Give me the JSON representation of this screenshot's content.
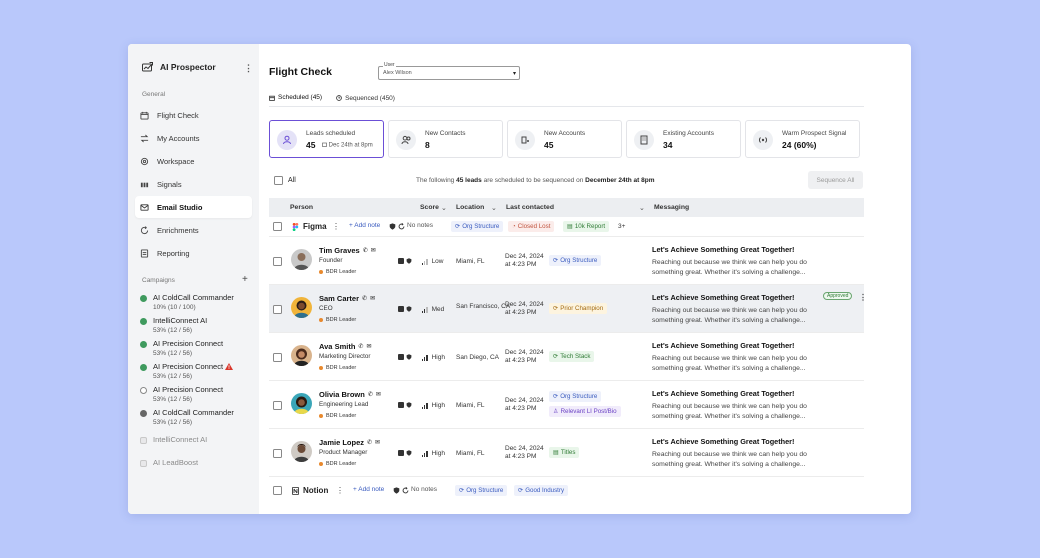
{
  "sidebar": {
    "app_name": "AI Prospector",
    "more": "⋮",
    "general_label": "General",
    "nav": [
      {
        "label": "Flight Check"
      },
      {
        "label": "My Accounts"
      },
      {
        "label": "Workspace"
      },
      {
        "label": "Signals"
      },
      {
        "label": "Email Studio"
      },
      {
        "label": "Enrichments"
      },
      {
        "label": "Reporting"
      }
    ],
    "campaigns_label": "Campaigns",
    "campaigns_add": "+",
    "campaigns": [
      {
        "name": "AI ColdCall Commander",
        "stat": "10% (10 / 100)"
      },
      {
        "name": "IntelliConnect AI",
        "stat": "53% (12 / 56)"
      },
      {
        "name": "AI Precision Connect",
        "stat": "53% (12 / 56)"
      },
      {
        "name": "AI Precision Connect",
        "stat": "53% (12 / 56)"
      },
      {
        "name": "AI Precision Connect",
        "stat": "53% (12 / 56)"
      },
      {
        "name": "AI ColdCall Commander",
        "stat": "53% (12 / 56)"
      },
      {
        "name": "IntelliConnect AI",
        "stat": ""
      },
      {
        "name": "AI LeadBoost",
        "stat": ""
      }
    ]
  },
  "header": {
    "title": "Flight Check",
    "user_label": "User",
    "user_value": "Alex Wilson",
    "caret": "▾"
  },
  "tabs": [
    {
      "label": "Scheduled (45)"
    },
    {
      "label": "Sequenced (450)"
    }
  ],
  "stats": [
    {
      "label": "Leads scheduled",
      "value": "45",
      "sub": "Dec 24th at 8pm"
    },
    {
      "label": "New Contacts",
      "value": "8"
    },
    {
      "label": "New Accounts",
      "value": "45"
    },
    {
      "label": "Existing Accounts",
      "value": "34"
    },
    {
      "label": "Warm Prospect Signal",
      "value": "24 (60%)"
    }
  ],
  "toolbar": {
    "all_label": "All",
    "note_pre": "The following ",
    "note_count": "45 leads",
    "note_mid": " are scheduled to be sequenced on ",
    "note_date": "December 24th at 8pm",
    "sequence_all": "Sequence All"
  },
  "columns": {
    "person": "Person",
    "score": "Score",
    "location": "Location",
    "last_contacted": "Last contacted",
    "messaging": "Messaging"
  },
  "groups": [
    {
      "name": "Figma",
      "add_note": "+ Add note",
      "no_notes": "No notes",
      "tags": [
        "Org Structure",
        "Closed Lost",
        "10k Report"
      ],
      "more": "3+"
    },
    {
      "name": "Notion",
      "add_note": "+ Add note",
      "no_notes": "No notes",
      "tags": [
        "Org Structure",
        "Good Industry"
      ]
    }
  ],
  "people": [
    {
      "name": "Tim Graves",
      "role": "Founder",
      "badge": "BDR Leader",
      "score": "Low",
      "score_level": 1,
      "location": "Miami, FL",
      "date": "Dec 24, 2024",
      "time": "at 4:23 PM",
      "tags": [
        "Org Structure"
      ],
      "msg_title": "Let's Achieve Something Great Together!",
      "msg_body": "Reaching out because we think we can help you do something great. Whether it's solving a challenge..."
    },
    {
      "name": "Sam Carter",
      "role": "CEO",
      "badge": "BDR Leader",
      "score": "Med",
      "score_level": 2,
      "location": "San Francisco, CA",
      "date": "Dec 24, 2024",
      "time": "at 4:23 PM",
      "tags": [
        "Prior Champion"
      ],
      "msg_title": "Let's Achieve Something Great Together!",
      "msg_body": "Reaching out because we think we can help you do something great. Whether it's solving a challenge...",
      "approved": "Approved"
    },
    {
      "name": "Ava Smith",
      "role": "Marketing Director",
      "badge": "BDR Leader",
      "score": "High",
      "score_level": 3,
      "location": "San Diego, CA",
      "date": "Dec 24, 2024",
      "time": "at 4:23 PM",
      "tags": [
        "Tech Stack"
      ],
      "msg_title": "Let's Achieve Something Great Together!",
      "msg_body": "Reaching out because we think we can help you do something great. Whether it's solving a challenge..."
    },
    {
      "name": "Olivia Brown",
      "role": "Engineering Lead",
      "badge": "BDR Leader",
      "score": "High",
      "score_level": 3,
      "location": "Miami, FL",
      "date": "Dec 24, 2024",
      "time": "at 4:23 PM",
      "tags": [
        "Org Structure",
        "Relevant LI Post/Bio"
      ],
      "msg_title": "Let's Achieve Something Great Together!",
      "msg_body": "Reaching out because we think we can help you do something great. Whether it's solving a challenge..."
    },
    {
      "name": "Jamie Lopez",
      "role": "Product Manager",
      "badge": "BDR Leader",
      "score": "High",
      "score_level": 3,
      "location": "Miami, FL",
      "date": "Dec 24, 2024",
      "time": "at 4:23 PM",
      "tags": [
        "Titles"
      ],
      "msg_title": "Let's Achieve Something Great Together!",
      "msg_body": "Reaching out because we think we can help you do something great. Whether it's solving a challenge..."
    }
  ],
  "colors": {
    "accent": "#6b4fd6",
    "green_dot": "#3f9a5e",
    "warning": "#d9362b",
    "background": "#b9c8fb"
  }
}
